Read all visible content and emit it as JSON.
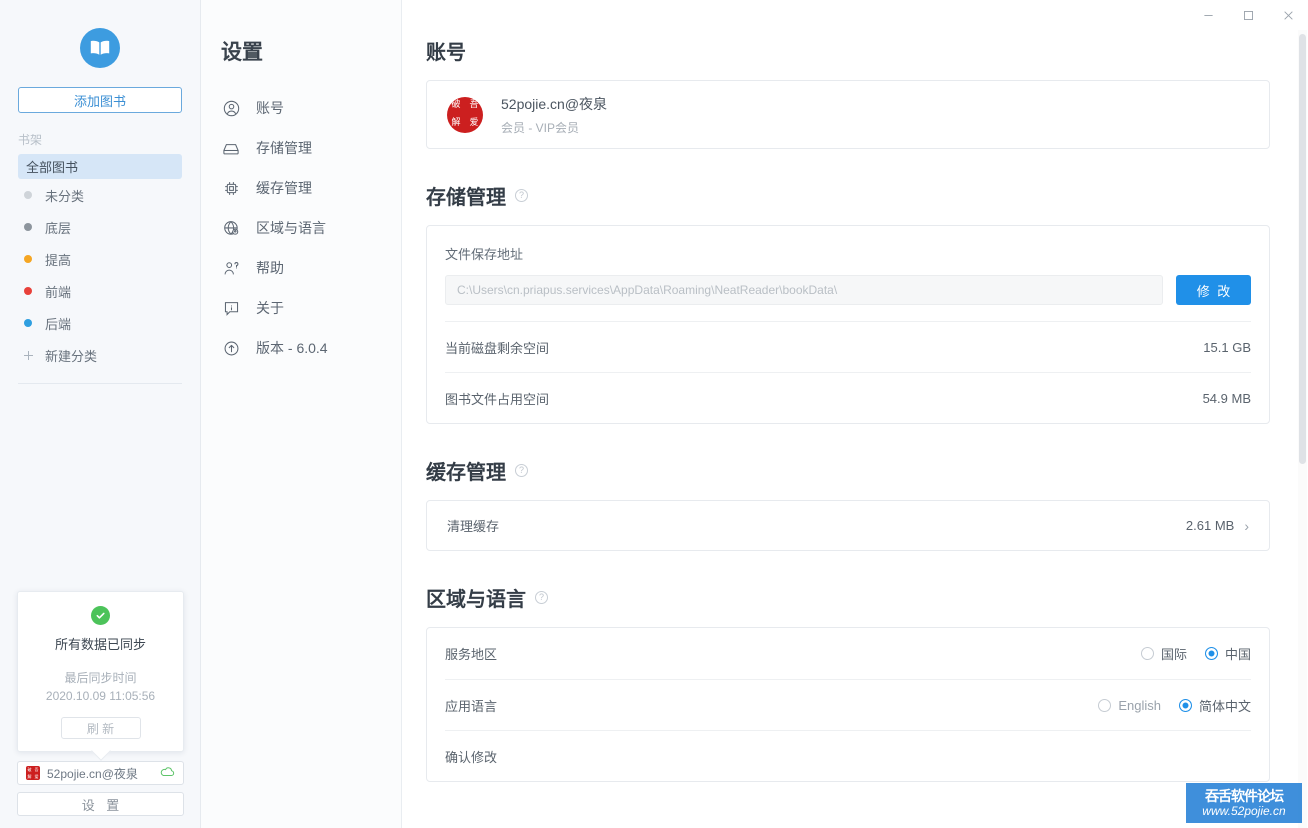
{
  "window": {
    "controls": [
      {
        "name": "minimize",
        "glyph": "─"
      },
      {
        "name": "maximize",
        "glyph": "□"
      },
      {
        "name": "close",
        "glyph": "✕"
      }
    ]
  },
  "sidebar": {
    "logo_icon": "open-book-icon",
    "add_book_label": "添加图书",
    "shelf_label": "书架",
    "all_books_label": "全部图书",
    "categories": [
      {
        "label": "未分类",
        "color": "#cfd4d9"
      },
      {
        "label": "底层",
        "color": "#8d959d"
      },
      {
        "label": "提高",
        "color": "#f5a623"
      },
      {
        "label": "前端",
        "color": "#e8413a"
      },
      {
        "label": "后端",
        "color": "#2f9fe0"
      }
    ],
    "new_category_label": "新建分类",
    "sync_popover": {
      "status_icon": "check-circle-icon",
      "title": "所有数据已同步",
      "subtitle": "最后同步时间",
      "timestamp": "2020.10.09 11:05:56",
      "refresh_label": "刷 新"
    },
    "account_bar": {
      "avatar_icon": "52pojie-seal-avatar",
      "name": "52pojie.cn@夜泉",
      "sync_icon": "cloud-sync-icon"
    },
    "settings_button_label": "设 置"
  },
  "settings_nav": {
    "title": "设置",
    "items": [
      {
        "label": "账号",
        "icon": "user-circle-icon"
      },
      {
        "label": "存储管理",
        "icon": "hard-drive-icon"
      },
      {
        "label": "缓存管理",
        "icon": "cpu-chip-icon"
      },
      {
        "label": "区域与语言",
        "icon": "globe-icon"
      },
      {
        "label": "帮助",
        "icon": "person-question-icon"
      },
      {
        "label": "关于",
        "icon": "info-box-icon"
      },
      {
        "label": "版本 - 6.0.4",
        "icon": "arrow-up-circle-icon"
      }
    ]
  },
  "main": {
    "account": {
      "heading": "账号",
      "avatar_icon": "52pojie-seal-avatar",
      "email": "52pojie.cn@夜泉",
      "membership": "会员 - VIP会员"
    },
    "storage": {
      "heading": "存储管理",
      "help_glyph": "?",
      "path_label": "文件保存地址",
      "path_value": "C:\\Users\\cn.priapus.services\\AppData\\Roaming\\NeatReader\\bookData\\",
      "modify_label": "修 改",
      "rows": [
        {
          "label": "当前磁盘剩余空间",
          "value": "15.1 GB"
        },
        {
          "label": "图书文件占用空间",
          "value": "54.9 MB"
        }
      ]
    },
    "cache": {
      "heading": "缓存管理",
      "help_glyph": "?",
      "clear_label": "清理缓存",
      "size": "2.61 MB",
      "chevron": "›"
    },
    "region": {
      "heading": "区域与语言",
      "help_glyph": "?",
      "service_region": {
        "label": "服务地区",
        "options": [
          {
            "label": "国际",
            "selected": false
          },
          {
            "label": "中国",
            "selected": true
          }
        ]
      },
      "app_language": {
        "label": "应用语言",
        "options": [
          {
            "label": "English",
            "selected": false
          },
          {
            "label": "简体中文",
            "selected": true
          }
        ]
      },
      "confirm_label": "确认修改"
    }
  },
  "watermark": {
    "line1": "吞舌软件论坛",
    "line2": "www.52pojie.cn"
  },
  "colors": {
    "accent_blue": "#2090e8",
    "logo_blue": "#3d9ce0",
    "seal_red": "#cc1f1f",
    "sync_green": "#4cc35a",
    "selected_bg": "#d6e6f7"
  }
}
